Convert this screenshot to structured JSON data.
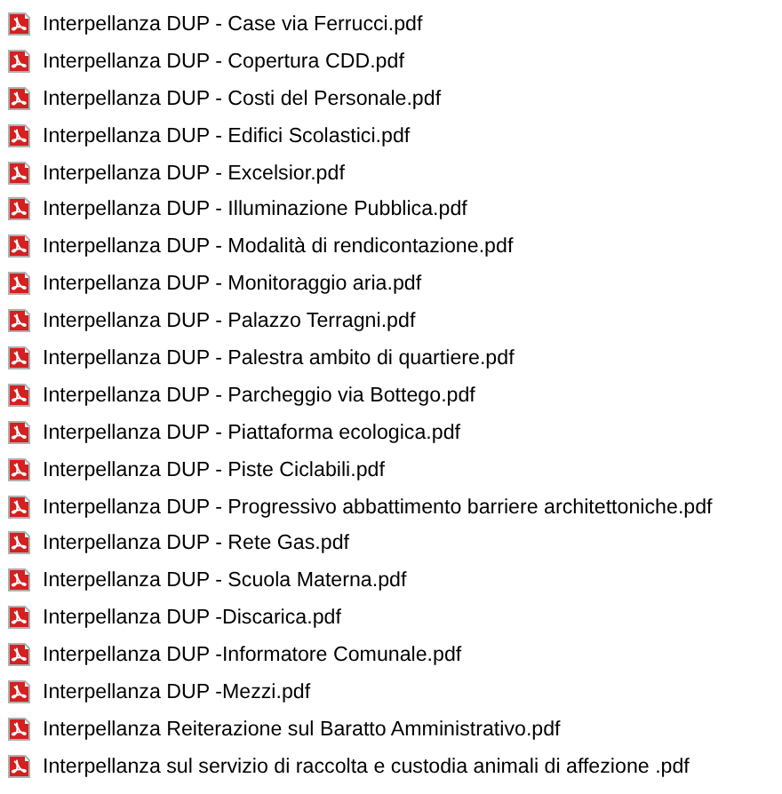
{
  "files": [
    {
      "name": "Interpellanza DUP - Case via Ferrucci.pdf"
    },
    {
      "name": "Interpellanza DUP - Copertura CDD.pdf"
    },
    {
      "name": "Interpellanza DUP - Costi del Personale.pdf"
    },
    {
      "name": "Interpellanza DUP - Edifici Scolastici.pdf"
    },
    {
      "name": "Interpellanza DUP - Excelsior.pdf"
    },
    {
      "name": "Interpellanza DUP - Illuminazione Pubblica.pdf"
    },
    {
      "name": "Interpellanza DUP - Modalità di rendicontazione.pdf"
    },
    {
      "name": "Interpellanza DUP - Monitoraggio aria.pdf"
    },
    {
      "name": "Interpellanza DUP - Palazzo Terragni.pdf"
    },
    {
      "name": "Interpellanza DUP - Palestra ambito di quartiere.pdf"
    },
    {
      "name": "Interpellanza DUP - Parcheggio via Bottego.pdf"
    },
    {
      "name": "Interpellanza DUP - Piattaforma ecologica.pdf"
    },
    {
      "name": "Interpellanza DUP - Piste Ciclabili.pdf"
    },
    {
      "name": "Interpellanza DUP - Progressivo abbattimento barriere architettoniche.pdf"
    },
    {
      "name": "Interpellanza DUP - Rete Gas.pdf"
    },
    {
      "name": "Interpellanza DUP - Scuola Materna.pdf"
    },
    {
      "name": "Interpellanza DUP -Discarica.pdf"
    },
    {
      "name": "Interpellanza DUP -Informatore Comunale.pdf"
    },
    {
      "name": "Interpellanza DUP -Mezzi.pdf"
    },
    {
      "name": "Interpellanza Reiterazione sul Baratto Amministrativo.pdf"
    },
    {
      "name": "Interpellanza sul servizio di raccolta e custodia animali di affezione .pdf"
    }
  ]
}
